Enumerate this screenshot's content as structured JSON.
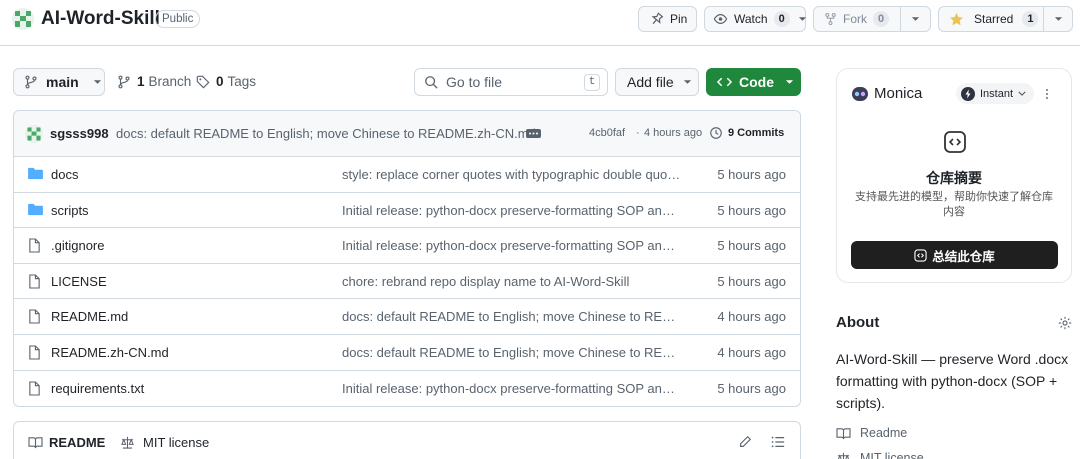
{
  "repo": {
    "name": "AI-Word-Skill",
    "visibility": "Public"
  },
  "actions": {
    "pin": "Pin",
    "watch": "Watch",
    "watch_count": "0",
    "fork": "Fork",
    "fork_count": "0",
    "starred": "Starred",
    "star_count": "1"
  },
  "toolbar": {
    "branch": "main",
    "branch_count": "1",
    "branch_label": "Branch",
    "tag_count": "0",
    "tag_label": "Tags",
    "goto_placeholder": "Go to file",
    "goto_kbd": "t",
    "add_file": "Add file",
    "code": "Code"
  },
  "latest_commit": {
    "author": "sgsss998",
    "message": "docs: default README to English; move Chinese to README.zh-CN.md",
    "hash": "4cb0faf",
    "time": "4 hours ago",
    "commits_count": "9",
    "commits_label": "Commits"
  },
  "files": [
    {
      "type": "folder",
      "name": "docs",
      "message": "style: replace corner quotes with typographic double quotes",
      "time": "5 hours ago"
    },
    {
      "type": "folder",
      "name": "scripts",
      "message": "Initial release: python-docx preserve-formatting SOP and ...",
      "time": "5 hours ago"
    },
    {
      "type": "file",
      "name": ".gitignore",
      "message": "Initial release: python-docx preserve-formatting SOP and ...",
      "time": "5 hours ago"
    },
    {
      "type": "file",
      "name": "LICENSE",
      "message": "chore: rebrand repo display name to AI-Word-Skill",
      "time": "5 hours ago"
    },
    {
      "type": "file",
      "name": "README.md",
      "message": "docs: default README to English; move Chinese to READ...",
      "time": "4 hours ago"
    },
    {
      "type": "file",
      "name": "README.zh-CN.md",
      "message": "docs: default README to English; move Chinese to READ...",
      "time": "4 hours ago"
    },
    {
      "type": "file",
      "name": "requirements.txt",
      "message": "Initial release: python-docx preserve-formatting SOP and ...",
      "time": "5 hours ago"
    }
  ],
  "readme_tabs": {
    "readme": "README",
    "license": "MIT license"
  },
  "monica": {
    "brand": "Monica",
    "mode": "Instant",
    "title": "仓库摘要",
    "desc": "支持最先进的模型，帮助你快速了解仓库内容",
    "button": "总结此仓库"
  },
  "about": {
    "title": "About",
    "description": "AI-Word-Skill — preserve Word .docx formatting with python-docx (SOP + scripts).",
    "links": [
      "Readme",
      "MIT license"
    ]
  },
  "colors": {
    "accent_green": "#1f883d",
    "folder_blue": "#54aeff",
    "star_yellow": "#eac54f"
  }
}
